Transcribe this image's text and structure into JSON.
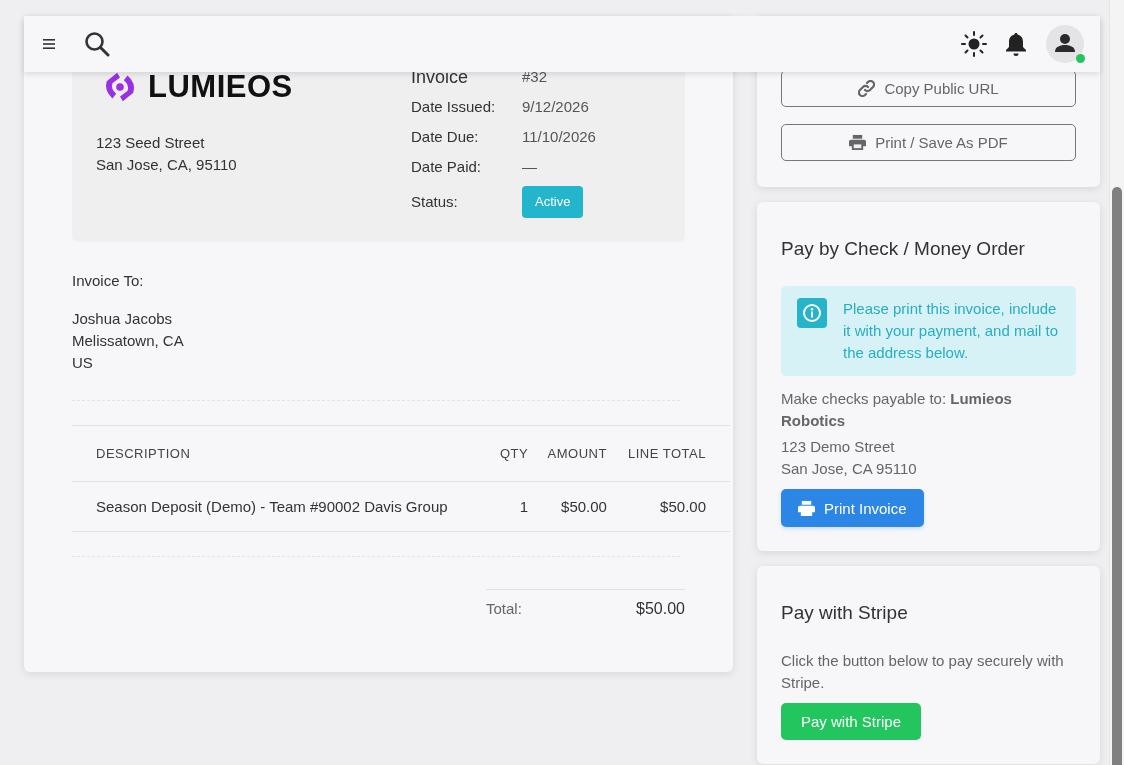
{
  "topbar": {
    "user": {
      "online": true
    }
  },
  "invoice": {
    "logo_text": "LUMIEOS",
    "sender_address": [
      "123 Seed Street",
      "San Jose, CA, 95110"
    ],
    "meta": [
      {
        "kind": "title",
        "label": "Invoice",
        "value": "#32"
      },
      {
        "kind": "text",
        "label": "Date Issued:",
        "value": "9/12/2026"
      },
      {
        "kind": "text",
        "label": "Date Due:",
        "value": "11/10/2026"
      },
      {
        "kind": "text",
        "label": "Date Paid:",
        "value": "—"
      },
      {
        "kind": "badge",
        "label": "Status:",
        "value": "Active"
      }
    ],
    "bill_to": {
      "heading": "Invoice To:",
      "lines": [
        "Joshua Jacobs",
        "Melissatown, CA",
        "US"
      ]
    },
    "table": {
      "columns": [
        "DESCRIPTION",
        "QTY",
        "AMOUNT",
        "LINE TOTAL"
      ],
      "rows": [
        [
          "Season Deposit (Demo) - Team #90002 Davis Group",
          "1",
          "$50.00",
          "$50.00"
        ]
      ]
    },
    "total": {
      "label": "Total:",
      "value": "$50.00"
    }
  },
  "actions": [
    {
      "label": "Copy Public URL"
    },
    {
      "label": "Print / Save As PDF"
    }
  ],
  "check_card": {
    "title": "Pay by Check / Money Order",
    "notice": "Please print this invoice, include it with your payment, and mail to the address below.",
    "payable": "Make checks payable to: **Lumieos Robotics**",
    "address": [
      "123 Demo Street",
      "San Jose, CA 95110"
    ],
    "button": {
      "label": "Print Invoice"
    }
  },
  "stripe_card": {
    "title": "Pay with Stripe",
    "text": "Click the button below to pay securely with Stripe.",
    "button": {
      "label": "Pay with Stripe"
    }
  }
}
